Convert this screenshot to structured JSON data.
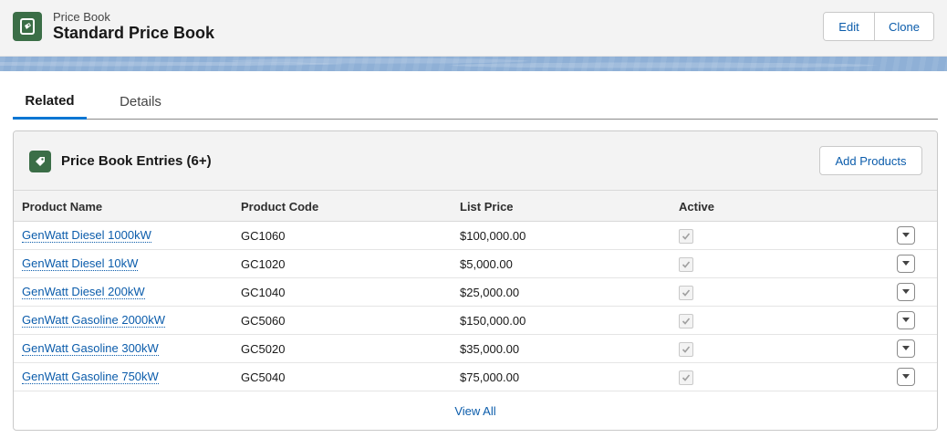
{
  "header": {
    "kicker": "Price Book",
    "title": "Standard Price Book",
    "icon": "price-book-icon",
    "accent_color": "#3b6e47",
    "edit_label": "Edit",
    "clone_label": "Clone"
  },
  "tabs": [
    {
      "label": "Related",
      "active": true
    },
    {
      "label": "Details",
      "active": false
    }
  ],
  "card": {
    "title": "Price Book Entries (6+)",
    "icon": "price-tag-icon",
    "add_label": "Add Products",
    "columns": [
      "Product Name",
      "Product Code",
      "List Price",
      "Active"
    ],
    "rows": [
      {
        "name": "GenWatt Diesel 1000kW",
        "code": "GC1060",
        "price": "$100,000.00",
        "active": true
      },
      {
        "name": "GenWatt Diesel 10kW",
        "code": "GC1020",
        "price": "$5,000.00",
        "active": true
      },
      {
        "name": "GenWatt Diesel 200kW",
        "code": "GC1040",
        "price": "$25,000.00",
        "active": true
      },
      {
        "name": "GenWatt Gasoline 2000kW",
        "code": "GC5060",
        "price": "$150,000.00",
        "active": true
      },
      {
        "name": "GenWatt Gasoline 300kW",
        "code": "GC5020",
        "price": "$35,000.00",
        "active": true
      },
      {
        "name": "GenWatt Gasoline 750kW",
        "code": "GC5040",
        "price": "$75,000.00",
        "active": true
      }
    ],
    "view_all_label": "View All"
  },
  "colors": {
    "link": "#0b5cab",
    "tab_active": "#0176d3",
    "banner": "#8fb0d6"
  }
}
